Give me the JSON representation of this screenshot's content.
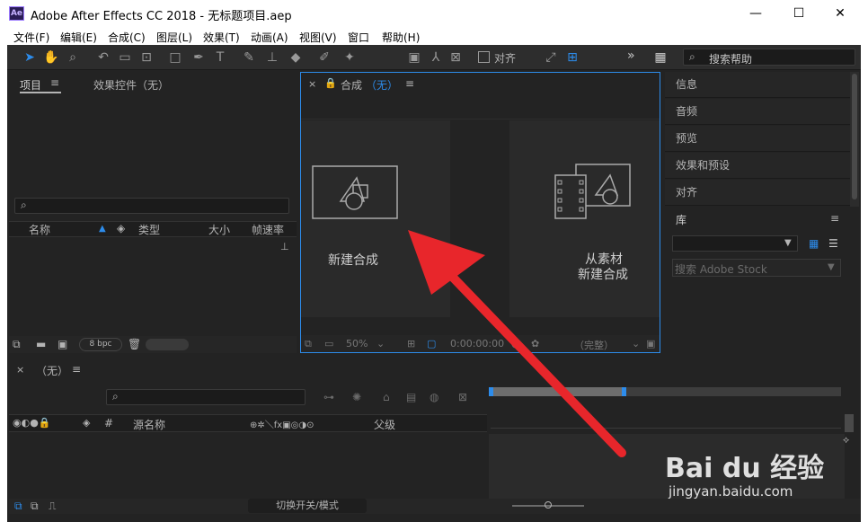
{
  "window": {
    "title": "Adobe After Effects CC 2018 - 无标题项目.aep",
    "logo": "Ae",
    "minimize": "—",
    "maximize": "☐",
    "close": "✕"
  },
  "menu": [
    "文件(F)",
    "编辑(E)",
    "合成(C)",
    "图层(L)",
    "效果(T)",
    "动画(A)",
    "视图(V)",
    "窗口",
    "帮助(H)"
  ],
  "toolbar": {
    "align_label": "对齐",
    "more": "»",
    "search_help": "搜索帮助"
  },
  "project_panel": {
    "tab_project": "项目",
    "tab_effects": "效果控件（无）",
    "columns": [
      "名称",
      "类型",
      "大小",
      "帧速率"
    ],
    "bpc": "8 bpc"
  },
  "comp_panel": {
    "tab_prefix": "合成",
    "tab_name": "（无）",
    "new_comp": "新建合成",
    "from_footage_line1": "从素材",
    "from_footage_line2": "新建合成",
    "zoom": "50%",
    "timecode": "0:00:00:00",
    "quality": "（完整）"
  },
  "right_panels": {
    "items": [
      "信息",
      "音频",
      "预览",
      "效果和预设",
      "对齐"
    ],
    "library": "库",
    "stock_search": "搜索 Adobe Stock"
  },
  "timeline": {
    "tab": "（无）",
    "col_hash": "#",
    "col_source": "源名称",
    "col_parent": "父级",
    "toggle_switch": "切换开关/模式"
  },
  "watermark": {
    "brand": "Bai du 经验",
    "url": "jingyan.baidu.com"
  },
  "colors": {
    "accent_blue": "#2d8ceb",
    "arrow_red": "#e8262b",
    "panel_bg": "#232323"
  }
}
